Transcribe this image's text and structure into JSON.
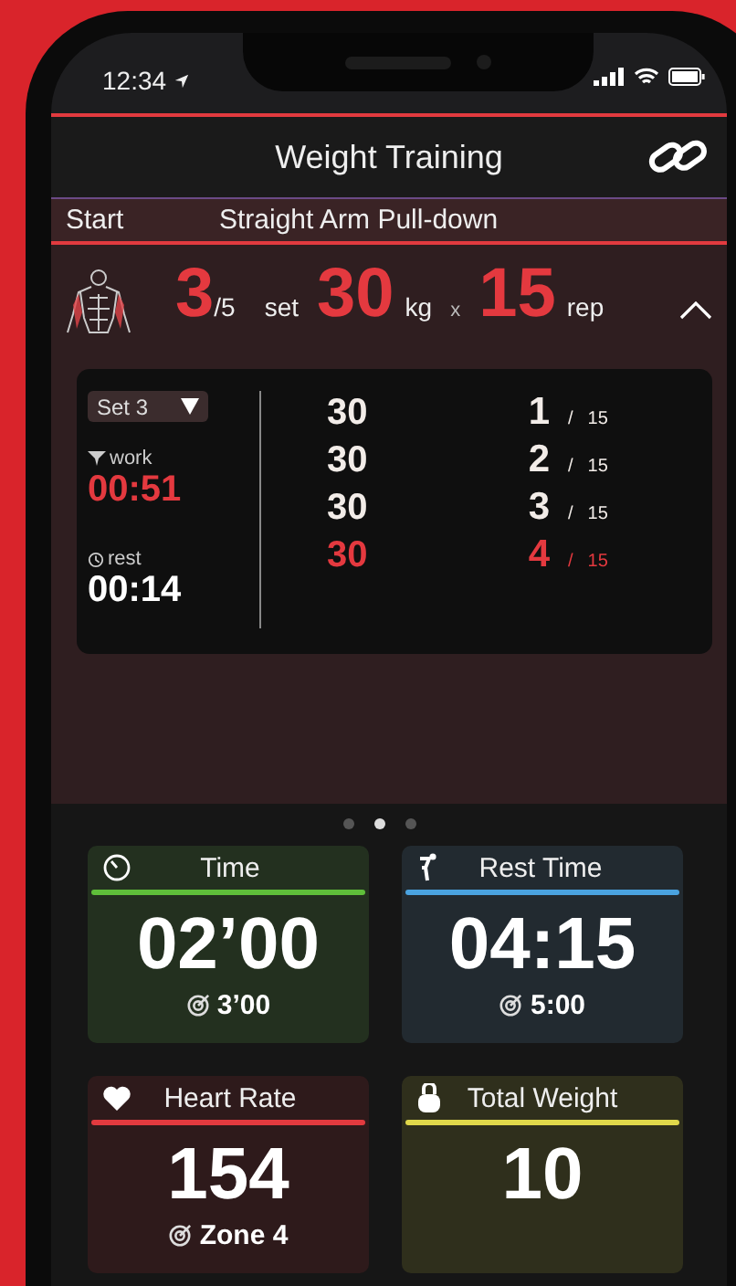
{
  "status_bar": {
    "time": "12:34"
  },
  "header": {
    "title": "Weight Training"
  },
  "exercise_bar": {
    "state": "Start",
    "name": "Straight Arm Pull-down"
  },
  "summary": {
    "set": "3",
    "set_total": "/5",
    "set_unit": "set",
    "weight": "30",
    "weight_unit": "kg",
    "times": "x",
    "reps": "15",
    "reps_unit": "rep",
    "expanded": true
  },
  "set_panel": {
    "set_picker": "Set 3",
    "work_label": "work",
    "work_time": "00:51",
    "rest_label": "rest",
    "rest_time": "00:14",
    "rows": [
      {
        "weight": "30",
        "rep": "1",
        "slash": "/",
        "total": "15",
        "active": false
      },
      {
        "weight": "30",
        "rep": "2",
        "slash": "/",
        "total": "15",
        "active": false
      },
      {
        "weight": "30",
        "rep": "3",
        "slash": "/",
        "total": "15",
        "active": false
      },
      {
        "weight": "30",
        "rep": "4",
        "slash": "/",
        "total": "15",
        "active": true
      }
    ]
  },
  "pager": [
    {
      "selected": false
    },
    {
      "selected": true
    },
    {
      "selected": false
    }
  ],
  "cards": [
    {
      "kind": "time",
      "title": "Time",
      "value": "02’00",
      "target": "3’00",
      "color": "#5fbf3a"
    },
    {
      "kind": "rest",
      "title": "Rest Time",
      "value": "04:15",
      "target": "5:00",
      "color": "#4aa3e0"
    },
    {
      "kind": "heart",
      "title": "Heart Rate",
      "value": "154",
      "target": "Zone 4",
      "color": "#e23a3f"
    },
    {
      "kind": "weight",
      "title": "Total Weight",
      "value": "10",
      "color": "#e0d84a"
    }
  ]
}
